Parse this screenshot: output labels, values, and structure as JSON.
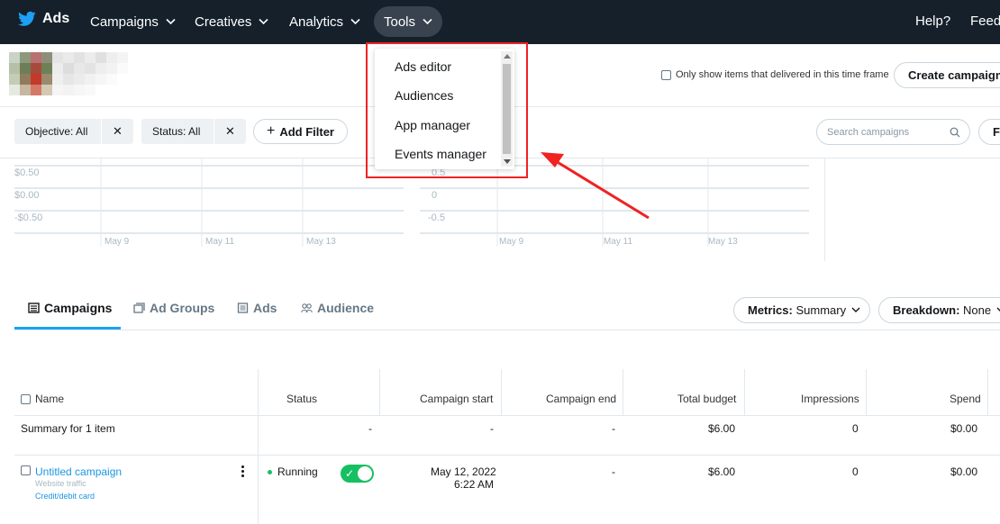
{
  "nav": {
    "brand": "Ads",
    "items": [
      {
        "label": "Campaigns"
      },
      {
        "label": "Creatives"
      },
      {
        "label": "Analytics"
      },
      {
        "label": "Tools"
      }
    ],
    "help": "Help?",
    "feedback": "Feedback"
  },
  "header": {
    "delivered_label": "Only show items that delivered in this time frame",
    "create_button": "Create campaign"
  },
  "filters": {
    "chips": [
      {
        "label": "Objective: All"
      },
      {
        "label": "Status: All"
      }
    ],
    "add_filter": "Add Filter",
    "search_placeholder": "Search campaigns",
    "extra_button": "F"
  },
  "charts": {
    "left": {
      "y_ticks": [
        "$0.50",
        "$0.00",
        "-$0.50"
      ],
      "x_ticks": [
        "May 9",
        "May 11",
        "May 13"
      ]
    },
    "right": {
      "y_ticks": [
        "0.5",
        "0",
        "-0.5"
      ],
      "x_ticks": [
        "May 9",
        "May 11",
        "May 13"
      ]
    }
  },
  "tabs": [
    {
      "label": "Campaigns"
    },
    {
      "label": "Ad Groups"
    },
    {
      "label": "Ads"
    },
    {
      "label": "Audience"
    }
  ],
  "metrics": {
    "label": "Metrics:",
    "value": "Summary"
  },
  "breakdown": {
    "label": "Breakdown:",
    "value": "None"
  },
  "table": {
    "headers": [
      "Name",
      "Status",
      "Campaign start",
      "Campaign end",
      "Total budget",
      "Impressions",
      "Spend"
    ],
    "summary": {
      "label": "Summary for 1 item",
      "status": "-",
      "start": "-",
      "end": "-",
      "budget": "$6.00",
      "impressions": "0",
      "spend": "$0.00"
    },
    "rows": [
      {
        "name": "Untitled campaign",
        "subtitle": "Website traffic",
        "payment": "Credit/debit card",
        "status": "Running",
        "start_date": "May 12, 2022",
        "start_time": "6:22 AM",
        "end": "-",
        "budget": "$6.00",
        "impressions": "0",
        "spend": "$0.00"
      }
    ]
  },
  "tools_menu": {
    "items": [
      "Ads editor",
      "Audiences",
      "App manager",
      "Events manager"
    ]
  },
  "colors": {
    "nav_bg": "#15202b",
    "accent": "#1da1f2",
    "running": "#17bf63",
    "annotation": "#f02222"
  }
}
